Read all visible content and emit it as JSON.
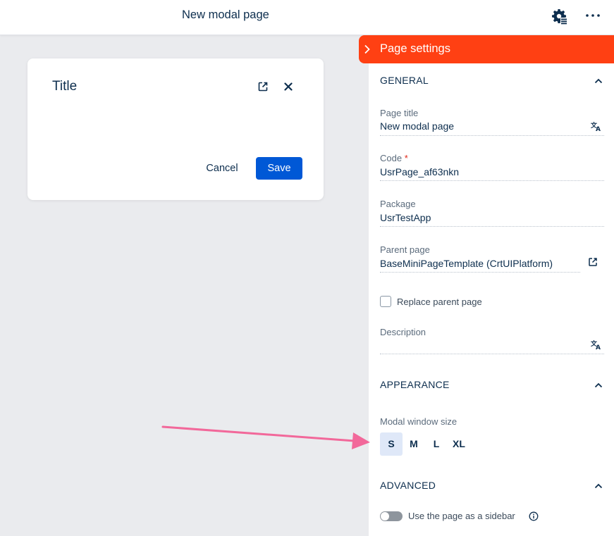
{
  "topbar": {
    "title": "New modal page",
    "gear_icon": "gear-settings-icon",
    "more_icon": "more-dots-icon"
  },
  "modal": {
    "title": "Title",
    "cancel_label": "Cancel",
    "save_label": "Save",
    "save_color": "#0058d6"
  },
  "panel": {
    "header_title": "Page settings",
    "header_color": "#ff4013",
    "general": {
      "heading": "GENERAL",
      "page_title_label": "Page title",
      "page_title_value": "New modal page",
      "code_label": "Code",
      "code_required": "*",
      "code_value": "UsrPage_af63nkn",
      "package_label": "Package",
      "package_value": "UsrTestApp",
      "parent_page_label": "Parent page",
      "parent_page_value": "BaseMiniPageTemplate (CrtUIPlatform)",
      "replace_parent_label": "Replace parent page",
      "replace_parent_checked": false,
      "description_label": "Description",
      "description_value": ""
    },
    "appearance": {
      "heading": "APPEARANCE",
      "modal_size_label": "Modal window size",
      "sizes": [
        "S",
        "M",
        "L",
        "XL"
      ],
      "selected_size": "S"
    },
    "advanced": {
      "heading": "ADVANCED",
      "sidebar_toggle_label": "Use the page as a sidebar",
      "sidebar_toggle_on": false
    }
  },
  "annotation": {
    "arrow_color": "#f2689a"
  }
}
